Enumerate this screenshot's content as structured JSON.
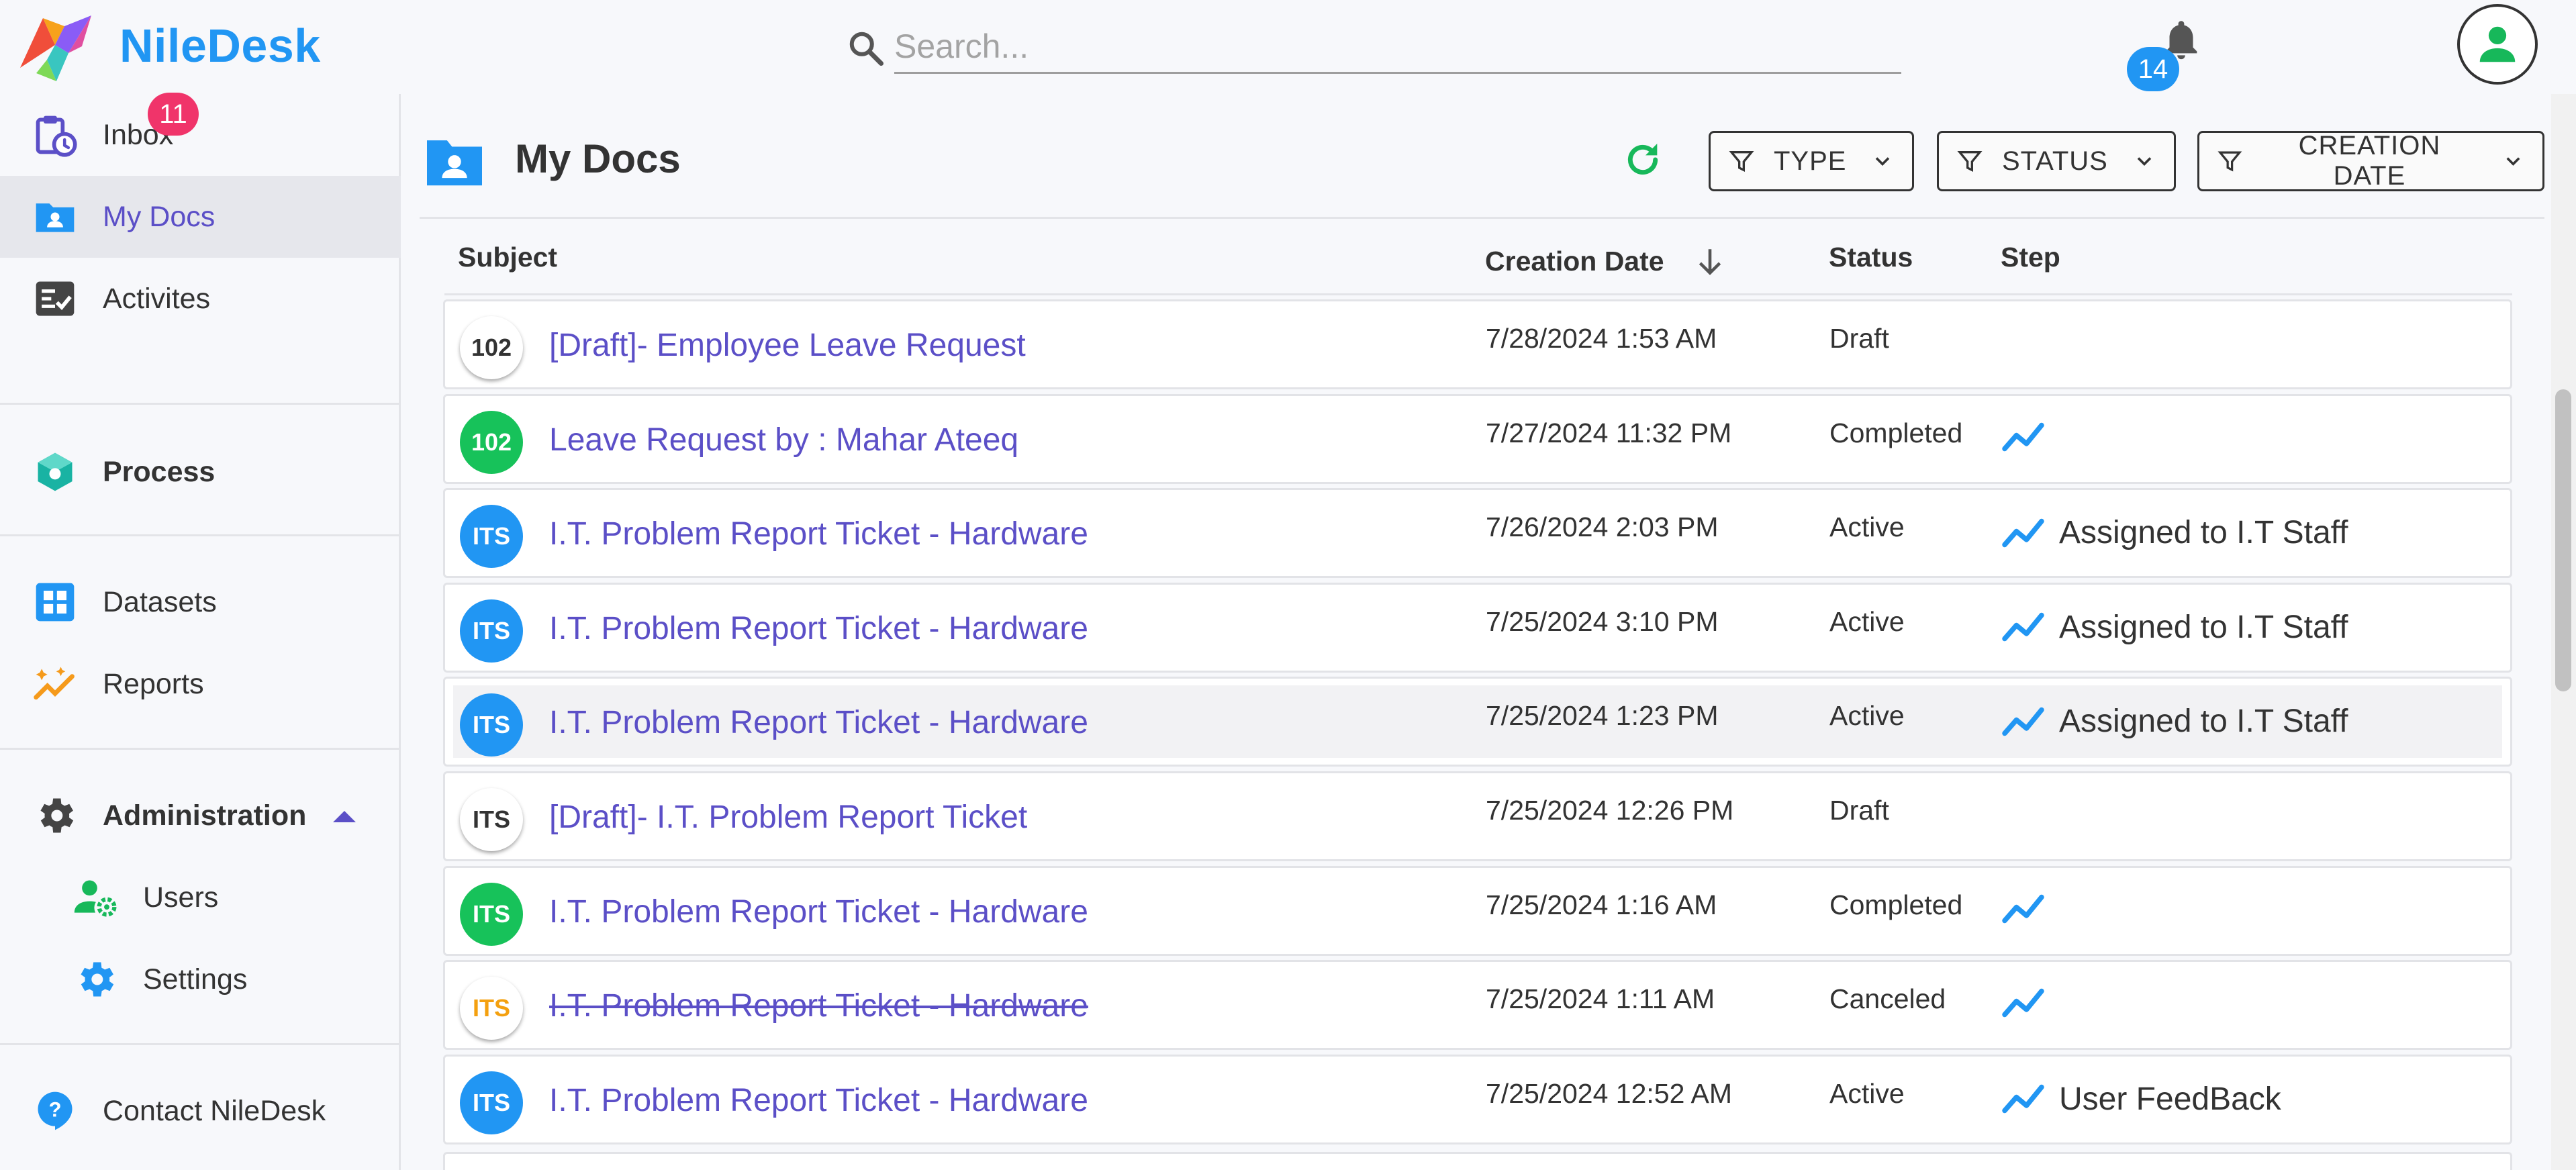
{
  "app": {
    "name": "NileDesk",
    "brand_color": "#2196f3",
    "accent_color": "#5b4fc7"
  },
  "header": {
    "search_placeholder": "Search...",
    "notifications_count": "14",
    "icons": [
      "logo-icon",
      "search-icon",
      "bell-icon",
      "user-avatar-icon"
    ]
  },
  "sidebar": {
    "inbox": {
      "label": "Inbox",
      "badge": "11",
      "icon": "clipboard-clock-icon"
    },
    "my_docs": {
      "label": "My Docs",
      "icon": "folder-user-icon",
      "active": true
    },
    "activities": {
      "label": "Activites",
      "icon": "checklist-icon"
    },
    "process": {
      "label": "Process",
      "icon": "cube-icon"
    },
    "datasets": {
      "label": "Datasets",
      "icon": "grid-icon"
    },
    "reports": {
      "label": "Reports",
      "icon": "sparkle-chart-icon"
    },
    "administration": {
      "label": "Administration",
      "icon": "gear-icon",
      "expanded": true
    },
    "users": {
      "label": "Users",
      "icon": "user-gear-icon"
    },
    "settings": {
      "label": "Settings",
      "icon": "gear-icon"
    },
    "contact": {
      "label": "Contact NileDesk",
      "icon": "help-bubble-icon"
    }
  },
  "main": {
    "title": "My Docs",
    "filters": {
      "type": "TYPE",
      "status": "STATUS",
      "creation_date": "CREATION DATE"
    },
    "columns": {
      "subject": "Subject",
      "creation_date": "Creation Date",
      "status": "Status",
      "step": "Step"
    },
    "rows": [
      {
        "chip": "102",
        "chip_style": "white",
        "subject": "[Draft]- Employee Leave Request",
        "date": "7/28/2024 1:53 AM",
        "status": "Draft",
        "step": "",
        "has_step_icon": false
      },
      {
        "chip": "102",
        "chip_style": "green",
        "subject": "Leave Request by : Mahar Ateeq",
        "date": "7/27/2024 11:32 PM",
        "status": "Completed",
        "step": "",
        "has_step_icon": true
      },
      {
        "chip": "ITS",
        "chip_style": "blue",
        "subject": "I.T. Problem Report Ticket - Hardware",
        "date": "7/26/2024 2:03 PM",
        "status": "Active",
        "step": "Assigned to I.T Staff",
        "has_step_icon": true
      },
      {
        "chip": "ITS",
        "chip_style": "blue",
        "subject": "I.T. Problem Report Ticket - Hardware",
        "date": "7/25/2024 3:10 PM",
        "status": "Active",
        "step": "Assigned to I.T Staff",
        "has_step_icon": true
      },
      {
        "chip": "ITS",
        "chip_style": "blue",
        "subject": "I.T. Problem Report Ticket - Hardware",
        "date": "7/25/2024 1:23 PM",
        "status": "Active",
        "step": "Assigned to I.T Staff",
        "has_step_icon": true,
        "highlighted": true
      },
      {
        "chip": "ITS",
        "chip_style": "white",
        "subject": "[Draft]- I.T. Problem Report Ticket",
        "date": "7/25/2024 12:26 PM",
        "status": "Draft",
        "step": "",
        "has_step_icon": false
      },
      {
        "chip": "ITS",
        "chip_style": "green",
        "subject": "I.T. Problem Report Ticket - Hardware",
        "date": "7/25/2024 1:16 AM",
        "status": "Completed",
        "step": "",
        "has_step_icon": true
      },
      {
        "chip": "ITS",
        "chip_style": "orange-text",
        "subject": "I.T. Problem Report Ticket - Hardware",
        "date": "7/25/2024 1:11 AM",
        "status": "Canceled",
        "step": "",
        "has_step_icon": true,
        "strikethrough": true
      },
      {
        "chip": "ITS",
        "chip_style": "blue",
        "subject": "I.T. Problem Report Ticket - Hardware",
        "date": "7/25/2024 12:52 AM",
        "status": "Active",
        "step": "User FeedBack",
        "has_step_icon": true
      }
    ]
  }
}
